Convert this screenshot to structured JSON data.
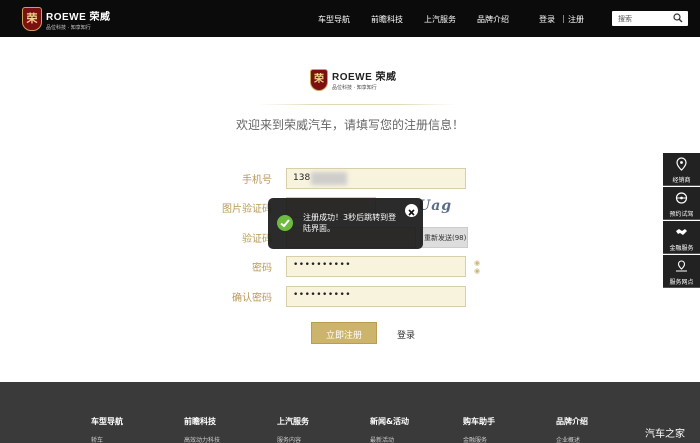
{
  "header": {
    "brand_name": "ROEWE 荣威",
    "brand_slogan": "品位科技 · 知享知行",
    "logo_glyph": "荣",
    "nav": [
      "车型导航",
      "前瞻科技",
      "上汽服务",
      "品牌介绍"
    ],
    "login": "登录",
    "separator": "|",
    "register": "注册",
    "search_placeholder": "搜索"
  },
  "page": {
    "welcome": "欢迎来到荣威汽车，请填写您的注册信息！"
  },
  "form": {
    "phone_label": "手机号",
    "phone_value": "138",
    "captcha_label": "图片验证码",
    "captcha_text": "Uag",
    "sms_label": "验证码",
    "sms_button": "重新发送(98)",
    "password_label": "密码",
    "password_value": "••••••••••",
    "confirm_label": "确认密码",
    "confirm_value": "••••••••••",
    "submit": "立即注册",
    "login_link": "登录"
  },
  "toast": {
    "message": "注册成功！3秒后跳转到登陆界面。"
  },
  "float_bar": [
    "经销商",
    "预约试驾",
    "金融服务",
    "服务网点"
  ],
  "footer": {
    "columns": [
      {
        "title": "车型导航",
        "first_link": "轿车"
      },
      {
        "title": "前瞻科技",
        "first_link": "高效动力科技"
      },
      {
        "title": "上汽服务",
        "first_link": "服务内容"
      },
      {
        "title": "新闻&活动",
        "first_link": "最新活动"
      },
      {
        "title": "购车助手",
        "first_link": "金融服务"
      },
      {
        "title": "品牌介绍",
        "first_link": "企业概述"
      }
    ]
  },
  "watermark": "汽车之家",
  "colors": {
    "accent": "#cdb46b",
    "label": "#b89a5a",
    "topbar": "#0b0b0b",
    "footer": "#3a3a3a"
  }
}
